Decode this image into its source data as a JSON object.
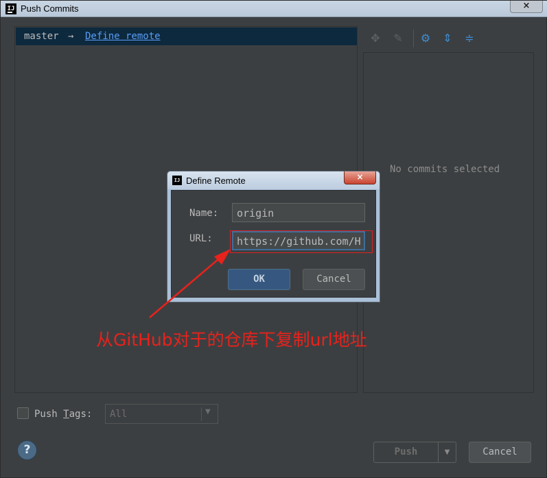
{
  "window": {
    "title": "Push Commits",
    "close_glyph": "×"
  },
  "branch": {
    "local": "master",
    "arrow": "→",
    "remote_link": "Define remote"
  },
  "toolbar": {
    "icons": [
      "move-icon",
      "edit-icon",
      "settings-icon",
      "expand-all-icon",
      "collapse-all-icon"
    ]
  },
  "right_panel": {
    "empty_text": "No commits selected"
  },
  "options": {
    "push_tags_prefix": "Push ",
    "push_tags_mnemonic": "T",
    "push_tags_suffix": "ags:",
    "tags_value": "All",
    "dropdown_glyph": "▼"
  },
  "buttons": {
    "help": "?",
    "push": "Push",
    "push_arrow": "▼",
    "cancel": "Cancel"
  },
  "dialog": {
    "title": "Define Remote",
    "close_glyph": "×",
    "name_label": "Name:",
    "name_value": "origin",
    "url_label": "URL:",
    "url_value": "https://github.com/H",
    "ok": "OK",
    "cancel": "Cancel"
  },
  "annotation": {
    "text": "从GitHub对于的仓库下复制url地址",
    "color": "#e8221c"
  },
  "colors": {
    "accent": "#365880",
    "link": "#589df6",
    "background": "#3c3f41"
  }
}
